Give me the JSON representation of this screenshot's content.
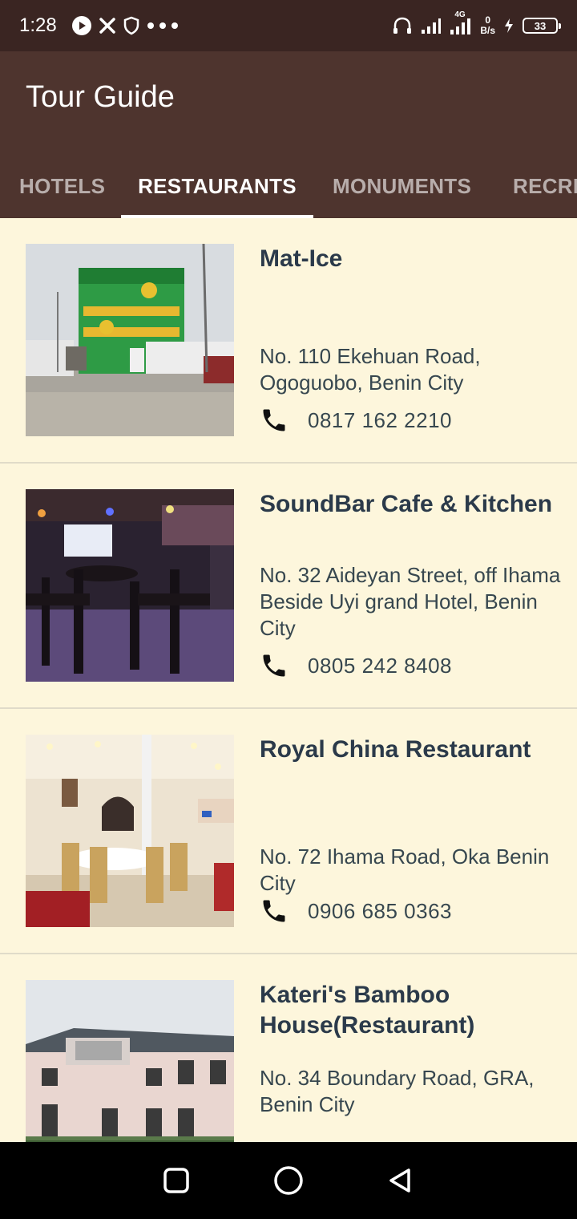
{
  "status_bar": {
    "time": "1:28",
    "left_icons": [
      "play-circle-icon",
      "x-icon",
      "shield-icon",
      "more-dots-icon"
    ],
    "right_icons": [
      "headphones-icon",
      "signal-icon",
      "signal-4g-icon"
    ],
    "net_speed_value": "0",
    "net_speed_unit": "B/s",
    "network_type": "4G",
    "battery": "33"
  },
  "app": {
    "title": "Tour Guide"
  },
  "tabs": [
    {
      "label": "HOTELS",
      "active": false
    },
    {
      "label": "RESTAURANTS",
      "active": true
    },
    {
      "label": "MONUMENTS",
      "active": false
    },
    {
      "label": "RECRE",
      "active": false
    }
  ],
  "restaurants": [
    {
      "name": "Mat-Ice",
      "address": "No. 110 Ekehuan Road, Ogoguobo, Benin City",
      "phone": "0817 162 2210"
    },
    {
      "name": "SoundBar Cafe & Kitchen",
      "address": "No. 32 Aideyan Street, off Ihama Beside Uyi grand Hotel, Benin City",
      "phone": "0805 242 8408"
    },
    {
      "name": "Royal China Restaurant",
      "address": "No. 72 Ihama Road, Oka Benin City",
      "phone": "0906 685 0363"
    },
    {
      "name": "Kateri's Bamboo House(Restaurant)",
      "address": "No. 34 Boundary Road, GRA, Benin City",
      "phone": ""
    }
  ],
  "nav": {
    "icons": [
      "recents-square-icon",
      "home-circle-icon",
      "back-triangle-icon"
    ]
  },
  "colors": {
    "status_bar": "#3A2522",
    "app_bar": "#4E342E",
    "background": "#FDF6DC",
    "title_text": "#2B3A4A",
    "body_text": "#37474F"
  }
}
